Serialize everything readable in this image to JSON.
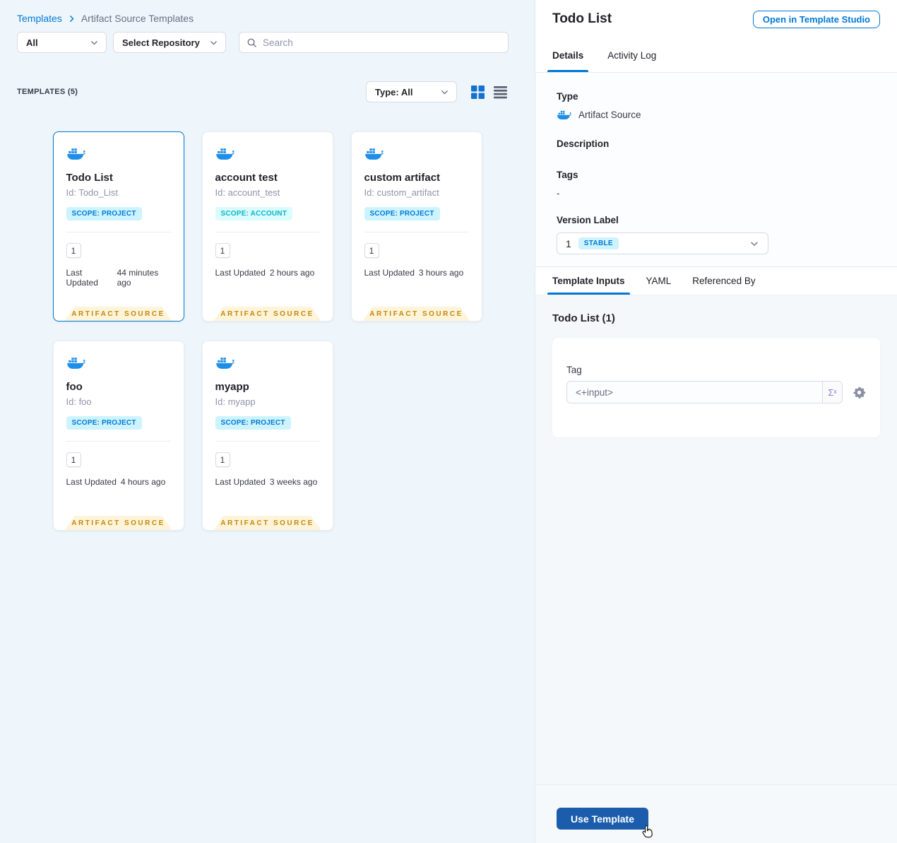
{
  "colors": {
    "accent": "#0278d5",
    "docker_blue": "#1e8ee6",
    "ribbon_text": "#c8860b",
    "use_template_bg": "#1b5dac",
    "scope_project_bg": "#cdf4fe",
    "scope_account_text": "#0ab5c9"
  },
  "breadcrumb": {
    "root": "Templates",
    "current": "Artifact Source Templates"
  },
  "filters": {
    "scope": "All",
    "repository": "Select Repository",
    "search_placeholder": "Search"
  },
  "list_header": {
    "count_label": "TEMPLATES (5)",
    "type_filter": "Type: All"
  },
  "cards": [
    {
      "title": "Todo List",
      "id": "Id: Todo_List",
      "scope": "SCOPE: PROJECT",
      "version": "1",
      "updated_label": "Last Updated",
      "updated_value": "44 minutes ago",
      "type_badge": "ARTIFACT SOURCE"
    },
    {
      "title": "account test",
      "id": "Id: account_test",
      "scope": "SCOPE: ACCOUNT",
      "version": "1",
      "updated_label": "Last Updated",
      "updated_value": "2 hours ago",
      "type_badge": "ARTIFACT SOURCE"
    },
    {
      "title": "custom artifact",
      "id": "Id: custom_artifact",
      "scope": "SCOPE: PROJECT",
      "version": "1",
      "updated_label": "Last Updated",
      "updated_value": "3 hours ago",
      "type_badge": "ARTIFACT SOURCE"
    },
    {
      "title": "foo",
      "id": "Id: foo",
      "scope": "SCOPE: PROJECT",
      "version": "1",
      "updated_label": "Last Updated",
      "updated_value": "4 hours ago",
      "type_badge": "ARTIFACT SOURCE"
    },
    {
      "title": "myapp",
      "id": "Id: myapp",
      "scope": "SCOPE: PROJECT",
      "version": "1",
      "updated_label": "Last Updated",
      "updated_value": "3 weeks ago",
      "type_badge": "ARTIFACT SOURCE"
    }
  ],
  "panel": {
    "title": "Todo List",
    "open_button": "Open in Template Studio",
    "tabs": {
      "details": "Details",
      "activity_log": "Activity Log"
    },
    "fields": {
      "type_label": "Type",
      "type_value": "Artifact Source",
      "description_label": "Description",
      "tags_label": "Tags",
      "tags_value": "-",
      "version_label": "Version Label",
      "version_value": "1",
      "version_badge": "STABLE"
    },
    "inner_tabs": {
      "template_inputs": "Template Inputs",
      "yaml": "YAML",
      "referenced_by": "Referenced By"
    },
    "inputs": {
      "heading": "Todo List (1)",
      "tag_label": "Tag",
      "tag_value": "<+input>",
      "expression_toggle": "Σˣ"
    },
    "footer": {
      "use_template": "Use Template"
    }
  }
}
